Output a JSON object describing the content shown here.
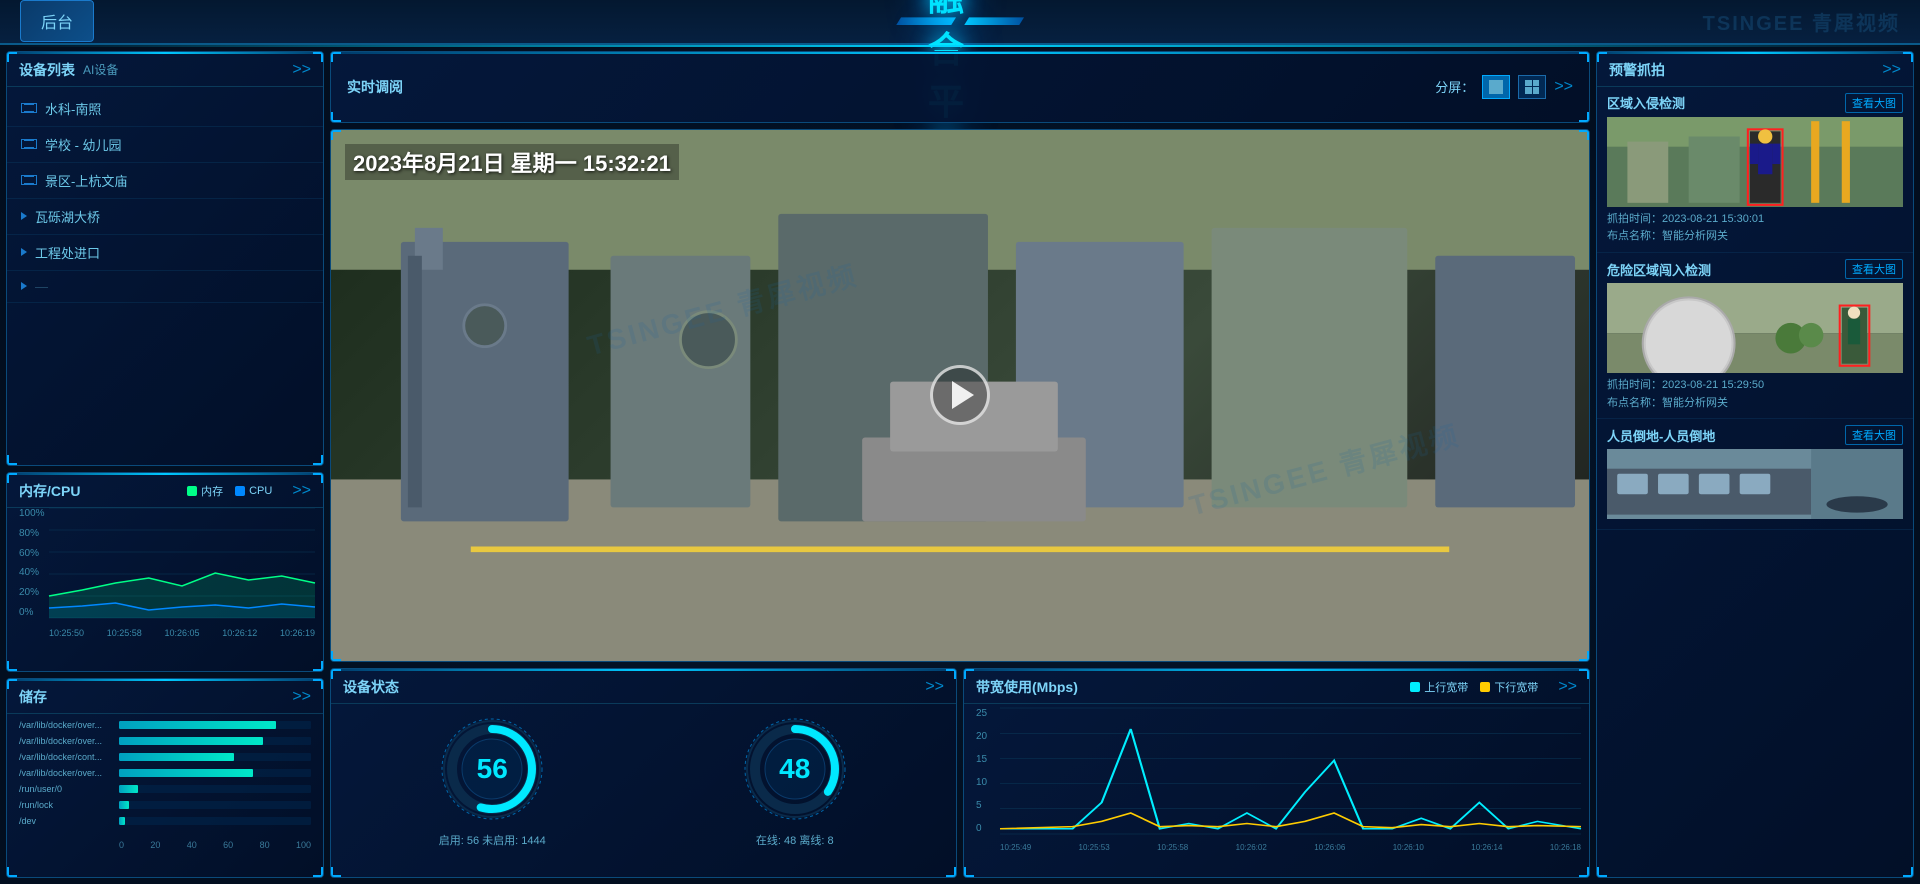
{
  "header": {
    "title": "视 频 融 合 平 台",
    "back_btn": "后台",
    "logo": "TSINGEE 青犀视频"
  },
  "left": {
    "device_list": {
      "title": "设备列表",
      "sub": "AI设备",
      "expand": ">>",
      "items": [
        {
          "icon": "list",
          "name": "水科-南照"
        },
        {
          "icon": "list",
          "name": "学校 - 幼儿园"
        },
        {
          "icon": "list",
          "name": "景区-上杭文庙"
        },
        {
          "icon": "arrow",
          "name": "瓦砾湖大桥"
        },
        {
          "icon": "arrow",
          "name": "工程处进口"
        }
      ]
    },
    "cpu_ram": {
      "title": "内存/CPU",
      "legend_mem": "内存",
      "legend_cpu": "CPU",
      "expand": ">>",
      "y_labels": [
        "100%",
        "80%",
        "60%",
        "40%",
        "20%",
        "0%"
      ],
      "x_labels": [
        "10:25:50",
        "10:25:58",
        "10:26:05",
        "10:26:12",
        "10:26:19"
      ],
      "color_mem": "#00ff88",
      "color_cpu": "#0088ff"
    },
    "storage": {
      "title": "储存",
      "expand": ">>",
      "items": [
        {
          "label": "/var/lib/docker/over...",
          "pct": 82
        },
        {
          "label": "/var/lib/docker/over...",
          "pct": 75
        },
        {
          "label": "/var/lib/docker/cont...",
          "pct": 60
        },
        {
          "label": "/var/lib/docker/over...",
          "pct": 70
        },
        {
          "label": "/run/user/0",
          "pct": 10
        },
        {
          "label": "/run/lock",
          "pct": 5
        },
        {
          "label": "/dev",
          "pct": 3
        }
      ],
      "x_labels": [
        "0",
        "20",
        "40",
        "60",
        "80",
        "100"
      ]
    }
  },
  "middle": {
    "realtime": {
      "title": "实时调阅",
      "split_label": "分屏：",
      "expand": ">>"
    },
    "video": {
      "datetime": "2023年8月21日 星期一 15:32:21"
    },
    "device_status": {
      "title": "设备状态",
      "expand": ">>",
      "online_value": 56,
      "offline_value": 48,
      "online_label": "启用: 56  未启用: 1444",
      "offline_label": "在线: 48  离线: 8"
    },
    "bandwidth": {
      "title": "带宽使用(Mbps)",
      "legend_up": "上行宽带",
      "legend_down": "下行宽带",
      "expand": ">>",
      "y_labels": [
        "25",
        "20",
        "15",
        "10",
        "5",
        "0"
      ],
      "x_labels": [
        "10:25:49",
        "10:25:53",
        "10:25:58",
        "10:26:02",
        "10:26:06",
        "10:26:10",
        "10:26:14",
        "10:26:18"
      ],
      "color_up": "#00eeff",
      "color_down": "#ffcc00"
    }
  },
  "right": {
    "title": "预警抓拍",
    "expand": ">>",
    "alerts": [
      {
        "title": "区域入侵检测",
        "view_btn": "查看大图",
        "capture_time": "抓拍时间：2023-08-21 15:30:01",
        "location": "布点名称：智能分析网关"
      },
      {
        "title": "危险区域闯入检测",
        "view_btn": "查看大图",
        "capture_time": "抓拍时间：2023-08-21 15:29:50",
        "location": "布点名称：智能分析网关"
      },
      {
        "title": "人员倒地-人员倒地",
        "view_btn": "查看大图",
        "capture_time": "",
        "location": ""
      }
    ]
  }
}
